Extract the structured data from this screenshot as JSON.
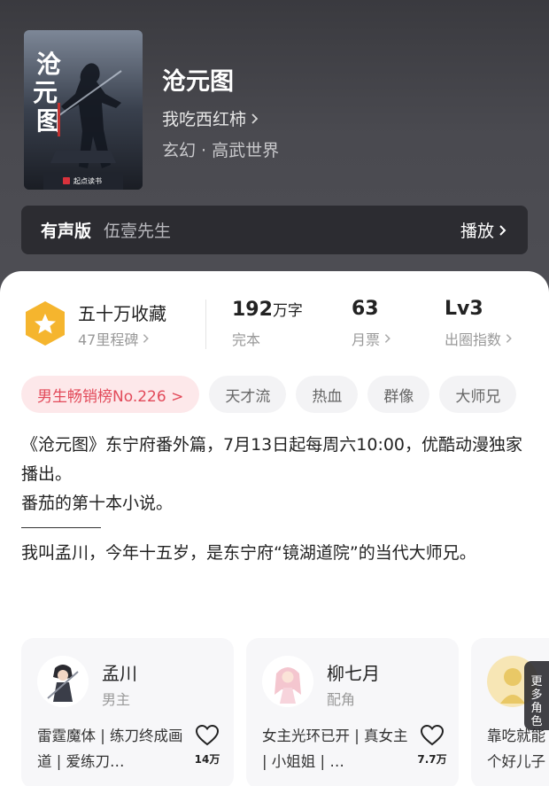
{
  "book": {
    "title": "沧元图",
    "author": "我吃西红柿",
    "genre": "玄幻 · 高武世界",
    "cover_title_chars": [
      "沧",
      "元",
      "图"
    ],
    "cover_publisher": "起点读书"
  },
  "audio": {
    "label": "有声版",
    "narrator": "伍壹先生",
    "play_label": "播放"
  },
  "stats": {
    "collect_main": "五十万收藏",
    "collect_sub": "47里程碑",
    "words_num": "192",
    "words_unit": "万字",
    "words_sub": "完本",
    "tickets_num": "63",
    "tickets_sub": "月票",
    "level_num": "Lv3",
    "level_sub": "出圈指数"
  },
  "tags": [
    {
      "label": "男生畅销榜No.226 >"
    },
    {
      "label": "天才流"
    },
    {
      "label": "热血"
    },
    {
      "label": "群像"
    },
    {
      "label": "大师兄"
    }
  ],
  "description": {
    "line1": "《沧元图》东宁府番外篇，7月13日起每周六10:00，优酷动漫独家播出。",
    "line2": "番茄的第十本小说。",
    "line3": "我叫孟川，今年十五岁，是东宁府“镜湖道院”的当代大师兄。"
  },
  "characters": [
    {
      "name": "孟川",
      "role": "男主",
      "desc": "雷霆魔体 | 练刀终成画道 | 爱练刀…",
      "likes": "14万"
    },
    {
      "name": "柳七月",
      "role": "配角",
      "desc": "女主光环已开 | 真女主 | 小姐姐 | …",
      "likes": "7.7万"
    },
    {
      "name": "",
      "role": "",
      "desc": "靠吃就能个好儿子",
      "likes": ""
    }
  ],
  "more_roles": [
    "更",
    "多",
    "角",
    "色"
  ],
  "colors": {
    "accent_red": "#e24a5a",
    "badge_gold": "#f5b52e",
    "header_bg": "#45454b"
  }
}
